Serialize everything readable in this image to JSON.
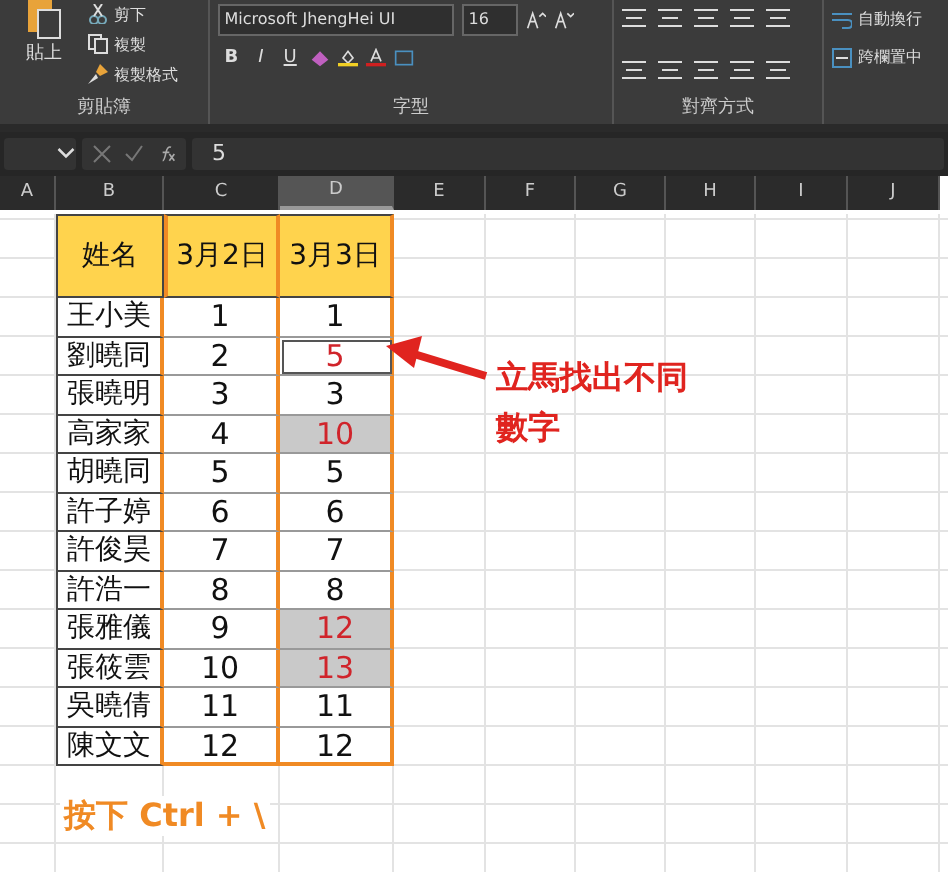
{
  "ribbon": {
    "groups": [
      {
        "kind": "clipboard",
        "label": "剪貼簿",
        "paste": "貼上",
        "items": [
          "剪下",
          "複製",
          "複製格式"
        ]
      },
      {
        "kind": "font",
        "label": "字型",
        "font_name": "Microsoft JhengHei UI",
        "font_size": "16",
        "styles": [
          "B",
          "I",
          "U"
        ]
      },
      {
        "kind": "alignment",
        "label": "對齊方式",
        "items": [
          "自動換行",
          "跨欄置中"
        ]
      }
    ]
  },
  "formula_bar": {
    "value": "5"
  },
  "columns": [
    {
      "label": "A",
      "selected": false
    },
    {
      "label": "B",
      "selected": false
    },
    {
      "label": "C",
      "selected": false
    },
    {
      "label": "D",
      "selected": true
    },
    {
      "label": "E",
      "selected": false
    },
    {
      "label": "F",
      "selected": false
    },
    {
      "label": "G",
      "selected": false
    },
    {
      "label": "H",
      "selected": false
    },
    {
      "label": "I",
      "selected": false
    },
    {
      "label": "J",
      "selected": false
    }
  ],
  "table": {
    "headers": [
      "姓名",
      "3月2日",
      "3月3日"
    ],
    "rows": [
      {
        "name": "王小美",
        "mar2": "1",
        "mar3": "1",
        "different": false,
        "active": false
      },
      {
        "name": "劉曉同",
        "mar2": "2",
        "mar3": "5",
        "different": true,
        "active": true
      },
      {
        "name": "張曉明",
        "mar2": "3",
        "mar3": "3",
        "different": false,
        "active": false
      },
      {
        "name": "高家家",
        "mar2": "4",
        "mar3": "10",
        "different": true,
        "active": false
      },
      {
        "name": "胡曉同",
        "mar2": "5",
        "mar3": "5",
        "different": false,
        "active": false
      },
      {
        "name": "許子婷",
        "mar2": "6",
        "mar3": "6",
        "different": false,
        "active": false
      },
      {
        "name": "許俊昊",
        "mar2": "7",
        "mar3": "7",
        "different": false,
        "active": false
      },
      {
        "name": "許浩一",
        "mar2": "8",
        "mar3": "8",
        "different": false,
        "active": false
      },
      {
        "name": "張雅儀",
        "mar2": "9",
        "mar3": "12",
        "different": true,
        "active": false
      },
      {
        "name": "張筱雲",
        "mar2": "10",
        "mar3": "13",
        "different": true,
        "active": false
      },
      {
        "name": "吳曉倩",
        "mar2": "11",
        "mar3": "11",
        "different": false,
        "active": false
      },
      {
        "name": "陳文文",
        "mar2": "12",
        "mar3": "12",
        "different": false,
        "active": false
      }
    ]
  },
  "annotation": "立馬找出不同數字",
  "shortcut_note": "按下 Ctrl + \\"
}
